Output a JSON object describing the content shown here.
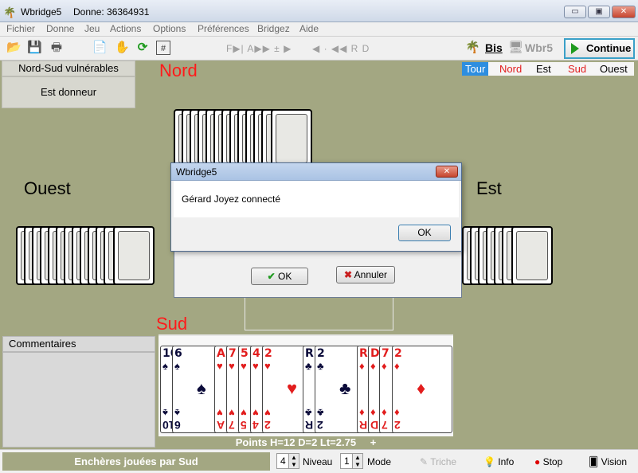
{
  "window": {
    "app_name": "Wbridge5",
    "deal_label": "Donne: 36364931",
    "buttons": {
      "minimize": "▭",
      "maximize": "▣",
      "close": "✕"
    }
  },
  "menu": [
    "Fichier",
    "Donne",
    "Jeu",
    "Actions",
    "Options",
    "Préférences",
    "Bridgez",
    "Aide"
  ],
  "toolbar": {
    "nav_group_1": "F▶| A▶▶ ± ▶",
    "nav_group_2": "◀ · ◀◀ R  D",
    "bis": "Bis",
    "wbr5": "Wbr5",
    "continue": "Continue"
  },
  "table": {
    "vulnerability": "Nord-Sud vulnérables",
    "dealer": "Est donneur",
    "seats": {
      "nord": "Nord",
      "sud": "Sud",
      "ouest": "Ouest",
      "est": "Est"
    },
    "turn_bar": {
      "tour": "Tour",
      "nord": "Nord",
      "est": "Est",
      "sud": "Sud",
      "ouest": "Ouest"
    },
    "colors": {
      "felt": "#a3a782",
      "seat_red": "#ff1a1a",
      "tour_bg": "#2d8ee0"
    }
  },
  "comments": {
    "header": "Commentaires"
  },
  "south_hand": {
    "cards": [
      {
        "rank": "10",
        "suit": "♠",
        "color": "black"
      },
      {
        "rank": "6",
        "suit": "♠",
        "color": "black"
      },
      {
        "rank": "A",
        "suit": "♥",
        "color": "red"
      },
      {
        "rank": "7",
        "suit": "♥",
        "color": "red"
      },
      {
        "rank": "5",
        "suit": "♥",
        "color": "red"
      },
      {
        "rank": "4",
        "suit": "♥",
        "color": "red"
      },
      {
        "rank": "2",
        "suit": "♥",
        "color": "red"
      },
      {
        "rank": "R",
        "suit": "♣",
        "color": "black"
      },
      {
        "rank": "2",
        "suit": "♣",
        "color": "black"
      },
      {
        "rank": "R",
        "suit": "♦",
        "color": "red"
      },
      {
        "rank": "D",
        "suit": "♦",
        "color": "red"
      },
      {
        "rank": "7",
        "suit": "♦",
        "color": "red"
      },
      {
        "rank": "2",
        "suit": "♦",
        "color": "red"
      }
    ],
    "points": "Points H=12 D=2  Lt=2.75",
    "plus": "+"
  },
  "statusbar": {
    "auctions": "Enchères jouées par Sud",
    "niveau_value": "4",
    "niveau_label": "Niveau",
    "mode_value": "1",
    "mode_label": "Mode",
    "triche": "Triche",
    "info": "Info",
    "stop": "Stop",
    "vision": "Vision"
  },
  "dialog": {
    "title": "Wbridge5",
    "message": "Gérard Joyez connecté",
    "ok": "OK"
  },
  "underlying_dialog": {
    "ok": "OK",
    "cancel": "Annuler"
  }
}
